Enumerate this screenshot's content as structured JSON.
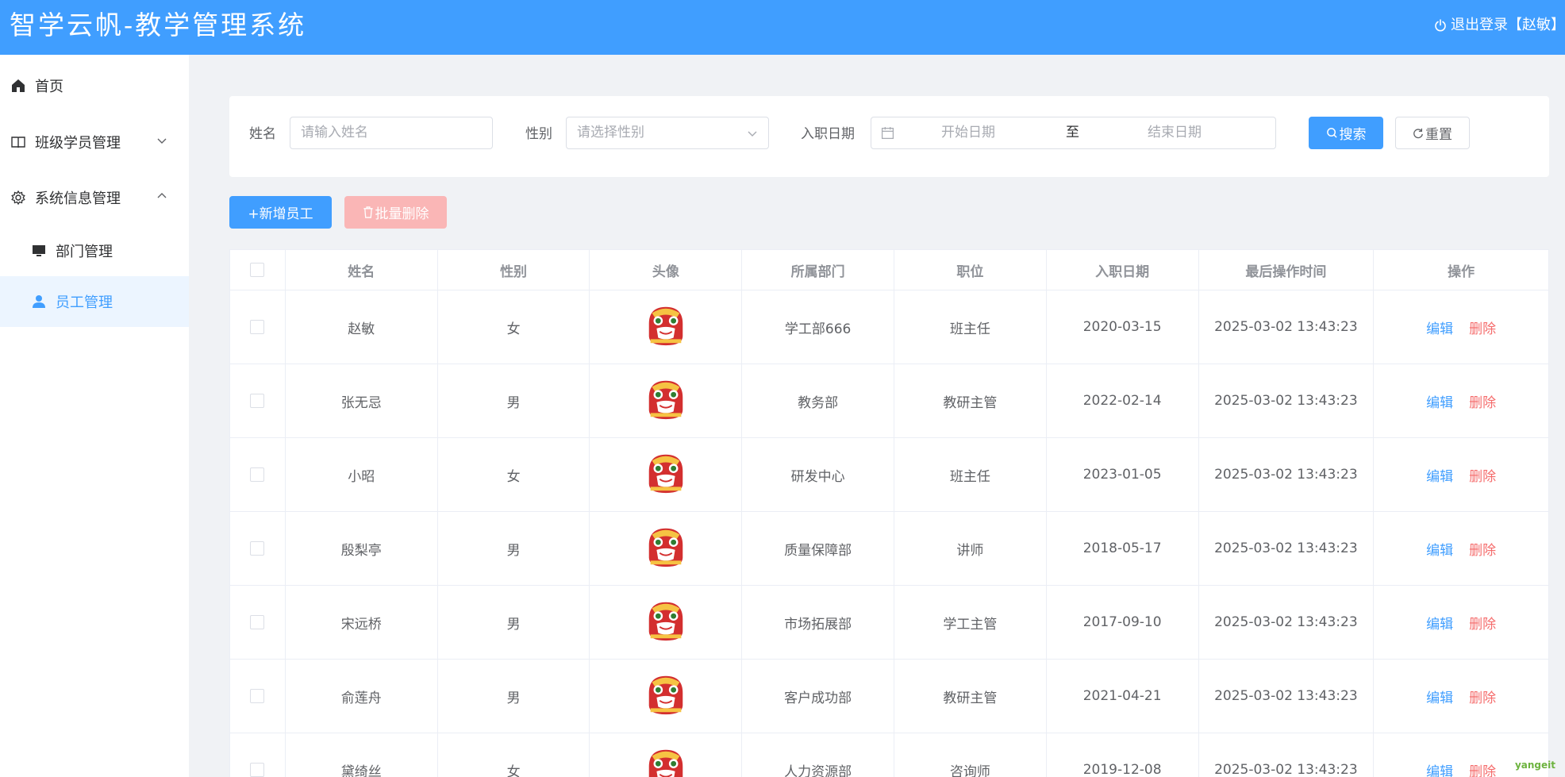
{
  "header": {
    "title": "智学云帆-教学管理系统",
    "logout_label": "退出登录【赵敏】",
    "logout_icon": "power-icon"
  },
  "sidebar": {
    "items": [
      {
        "label": "首页",
        "icon": "home-icon"
      },
      {
        "label": "班级学员管理",
        "icon": "book-icon",
        "expanded": false
      },
      {
        "label": "系统信息管理",
        "icon": "gear-icon",
        "expanded": true
      },
      {
        "label": "部门管理",
        "icon": "monitor-icon"
      },
      {
        "label": "员工管理",
        "icon": "user-icon",
        "active": true
      }
    ]
  },
  "search": {
    "name_label": "姓名",
    "name_placeholder": "请输入姓名",
    "gender_label": "性别",
    "gender_placeholder": "请选择性别",
    "date_label": "入职日期",
    "start_placeholder": "开始日期",
    "range_separator": "至",
    "end_placeholder": "结束日期",
    "search_button": "搜索",
    "reset_button": "重置"
  },
  "toolbar": {
    "add_button": "+新增员工",
    "batch_delete_button": "批量删除"
  },
  "table": {
    "columns": [
      "姓名",
      "性别",
      "头像",
      "所属部门",
      "职位",
      "入职日期",
      "最后操作时间",
      "操作"
    ],
    "edit_label": "编辑",
    "delete_label": "删除",
    "rows": [
      {
        "name": "赵敏",
        "gender": "女",
        "dept": "学工部666",
        "position": "班主任",
        "entry_date": "2020-03-15",
        "updated": "2025-03-02 13:43:23"
      },
      {
        "name": "张无忌",
        "gender": "男",
        "dept": "教务部",
        "position": "教研主管",
        "entry_date": "2022-02-14",
        "updated": "2025-03-02 13:43:23"
      },
      {
        "name": "小昭",
        "gender": "女",
        "dept": "研发中心",
        "position": "班主任",
        "entry_date": "2023-01-05",
        "updated": "2025-03-02 13:43:23"
      },
      {
        "name": "殷梨亭",
        "gender": "男",
        "dept": "质量保障部",
        "position": "讲师",
        "entry_date": "2018-05-17",
        "updated": "2025-03-02 13:43:23"
      },
      {
        "name": "宋远桥",
        "gender": "男",
        "dept": "市场拓展部",
        "position": "学工主管",
        "entry_date": "2017-09-10",
        "updated": "2025-03-02 13:43:23"
      },
      {
        "name": "俞莲舟",
        "gender": "男",
        "dept": "客户成功部",
        "position": "教研主管",
        "entry_date": "2021-04-21",
        "updated": "2025-03-02 13:43:23"
      },
      {
        "name": "黛绮丝",
        "gender": "女",
        "dept": "人力资源部",
        "position": "咨询师",
        "entry_date": "2019-12-08",
        "updated": "2025-03-02 13:43:23"
      }
    ]
  },
  "watermark": "yangeit",
  "colors": {
    "primary": "#409eff",
    "danger": "#f56c6c",
    "sidebar_active_bg": "#ecf5ff",
    "page_bg": "#f0f2f5"
  }
}
